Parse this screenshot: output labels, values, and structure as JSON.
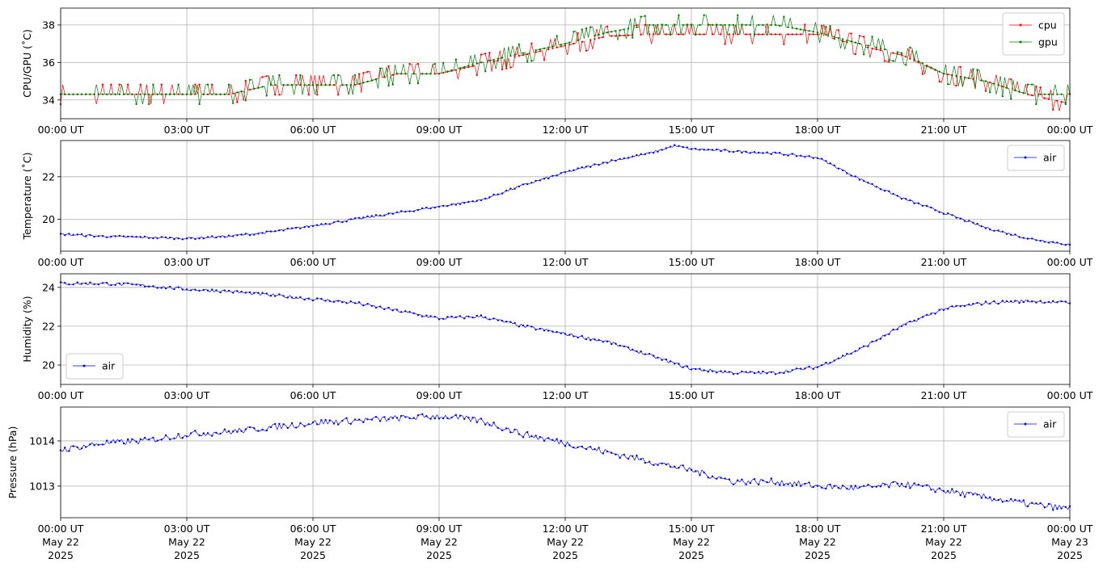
{
  "x_tick_labels": [
    "00:00 UT",
    "03:00 UT",
    "06:00 UT",
    "09:00 UT",
    "12:00 UT",
    "15:00 UT",
    "18:00 UT",
    "21:00 UT",
    "00:00 UT"
  ],
  "bottom_x_tick_labels": [
    [
      "00:00 UT",
      "May 22",
      "2025"
    ],
    [
      "03:00 UT",
      "May 22",
      "2025"
    ],
    [
      "06:00 UT",
      "May 22",
      "2025"
    ],
    [
      "09:00 UT",
      "May 22",
      "2025"
    ],
    [
      "12:00 UT",
      "May 22",
      "2025"
    ],
    [
      "15:00 UT",
      "May 22",
      "2025"
    ],
    [
      "18:00 UT",
      "May 22",
      "2025"
    ],
    [
      "21:00 UT",
      "May 22",
      "2025"
    ],
    [
      "00:00 UT",
      "May 23",
      "2025"
    ]
  ],
  "chart_data": [
    {
      "type": "line",
      "ylabel": "CPU/GPU (˚C)",
      "xlim": [
        "2025-05-22 00:00 UT",
        "2025-05-23 00:00 UT"
      ],
      "ylim": [
        33.0,
        38.9
      ],
      "yticks": [
        34,
        36,
        38
      ],
      "grid": true,
      "legend": "top-right",
      "x_hours": [
        0,
        1,
        2,
        3,
        4,
        5,
        6,
        7,
        8,
        9,
        10,
        11,
        12,
        13,
        14,
        15,
        16,
        17,
        18,
        19,
        20,
        21,
        22,
        23,
        24
      ],
      "series": [
        {
          "name": "cpu",
          "color": "#ff0000",
          "values": [
            34.3,
            34.3,
            34.3,
            34.3,
            34.3,
            34.8,
            34.8,
            34.8,
            35.4,
            35.4,
            35.9,
            36.4,
            36.9,
            37.4,
            37.5,
            37.5,
            37.5,
            37.5,
            37.5,
            36.9,
            36.4,
            35.4,
            35.0,
            34.3,
            33.8
          ]
        },
        {
          "name": "gpu",
          "color": "#008000",
          "values": [
            34.3,
            34.3,
            34.3,
            34.3,
            34.3,
            34.8,
            34.8,
            34.8,
            35.4,
            35.4,
            36.0,
            36.5,
            37.0,
            37.6,
            38.0,
            38.0,
            38.0,
            38.0,
            37.6,
            37.0,
            36.5,
            35.4,
            35.0,
            34.3,
            34.3
          ]
        }
      ]
    },
    {
      "type": "line",
      "ylabel": "Temperature (˚C)",
      "xlim": [
        "2025-05-22 00:00 UT",
        "2025-05-23 00:00 UT"
      ],
      "ylim": [
        18.5,
        23.7
      ],
      "yticks": [
        20,
        22
      ],
      "grid": true,
      "legend": "top-right",
      "x_hours": [
        0,
        1,
        2,
        3,
        4,
        5,
        6,
        7,
        8,
        9,
        10,
        11,
        12,
        13,
        14,
        14.6,
        15,
        16,
        17,
        18,
        19,
        20,
        21,
        22,
        23,
        24
      ],
      "series": [
        {
          "name": "air",
          "color": "#0000ff",
          "values": [
            19.3,
            19.2,
            19.15,
            19.1,
            19.2,
            19.4,
            19.7,
            20.0,
            20.3,
            20.6,
            20.9,
            21.6,
            22.2,
            22.7,
            23.1,
            23.45,
            23.3,
            23.2,
            23.1,
            22.9,
            21.9,
            21.0,
            20.3,
            19.6,
            19.1,
            18.8
          ]
        }
      ]
    },
    {
      "type": "line",
      "ylabel": "Humidity (%)",
      "xlim": [
        "2025-05-22 00:00 UT",
        "2025-05-23 00:00 UT"
      ],
      "ylim": [
        19.0,
        24.7
      ],
      "yticks": [
        20,
        22,
        24
      ],
      "grid": true,
      "legend": "bottom-left",
      "x_hours": [
        0,
        1,
        2,
        3,
        4,
        5,
        6,
        7,
        8,
        9,
        10,
        11,
        12,
        13,
        14,
        15,
        16,
        17,
        18,
        19,
        20,
        21,
        22,
        23,
        24
      ],
      "series": [
        {
          "name": "air",
          "color": "#0000ff",
          "values": [
            24.2,
            24.2,
            24.1,
            23.9,
            23.8,
            23.6,
            23.4,
            23.2,
            22.8,
            22.4,
            22.5,
            22.0,
            21.6,
            21.2,
            20.5,
            19.8,
            19.6,
            19.6,
            19.9,
            20.8,
            22.0,
            22.9,
            23.2,
            23.3,
            23.2
          ]
        }
      ]
    },
    {
      "type": "line",
      "ylabel": "Pressure (hPa)",
      "xlim": [
        "2025-05-22 00:00 UT",
        "2025-05-23 00:00 UT"
      ],
      "ylim": [
        1012.3,
        1014.75
      ],
      "yticks": [
        1013,
        1014
      ],
      "grid": true,
      "legend": "top-right",
      "x_hours": [
        0,
        1,
        2,
        3,
        4,
        5,
        6,
        7,
        8,
        9,
        10,
        11,
        12,
        13,
        14,
        15,
        16,
        17,
        18,
        19,
        20,
        21,
        22,
        23,
        24
      ],
      "series": [
        {
          "name": "air",
          "color": "#0000ff",
          "values": [
            1013.8,
            1013.95,
            1014.0,
            1014.15,
            1014.2,
            1014.3,
            1014.4,
            1014.45,
            1014.5,
            1014.55,
            1014.45,
            1014.15,
            1013.95,
            1013.75,
            1013.55,
            1013.35,
            1013.1,
            1013.1,
            1013.0,
            1012.95,
            1013.05,
            1012.9,
            1012.75,
            1012.6,
            1012.5
          ]
        }
      ]
    }
  ]
}
